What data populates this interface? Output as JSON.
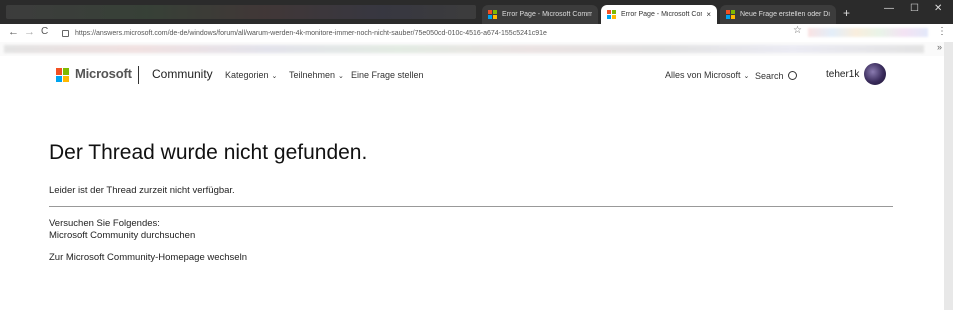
{
  "browser": {
    "tabs": [
      {
        "label": "Error Page - Microsoft Commun",
        "active": false
      },
      {
        "label": "Error Page - Microsoft Commun",
        "active": true
      },
      {
        "label": "Neue Frage erstellen oder Disku",
        "active": false
      }
    ],
    "new_tab_symbol": "+",
    "window_controls": [
      "—",
      "☐",
      "✕"
    ],
    "url": "https://answers.microsoft.com/de-de/windows/forum/all/warum-werden-4k-monitore-immer-noch-nicht-sauber/75e050cd-010c-4516-a674-155c5241c91e",
    "nav": {
      "back": "←",
      "forward": "→",
      "reload": "C"
    },
    "star": "☆",
    "menu": "⋮"
  },
  "header": {
    "brand": "Microsoft",
    "community": "Community",
    "nav": [
      {
        "label": "Kategorien",
        "chevron": true
      },
      {
        "label": "Teilnehmen",
        "chevron": true
      },
      {
        "label": "Eine Frage stellen",
        "chevron": false
      }
    ],
    "all_microsoft": "Alles von Microsoft",
    "search": "Search",
    "username": "teher1k"
  },
  "main": {
    "title": "Der Thread wurde nicht gefunden.",
    "subtitle": "Leider ist der Thread zurzeit nicht verfügbar.",
    "try_heading": "Versuchen Sie Folgendes:",
    "link_search": "Microsoft Community durchsuchen",
    "link_home": "Zur Microsoft Community-Homepage wechseln"
  }
}
